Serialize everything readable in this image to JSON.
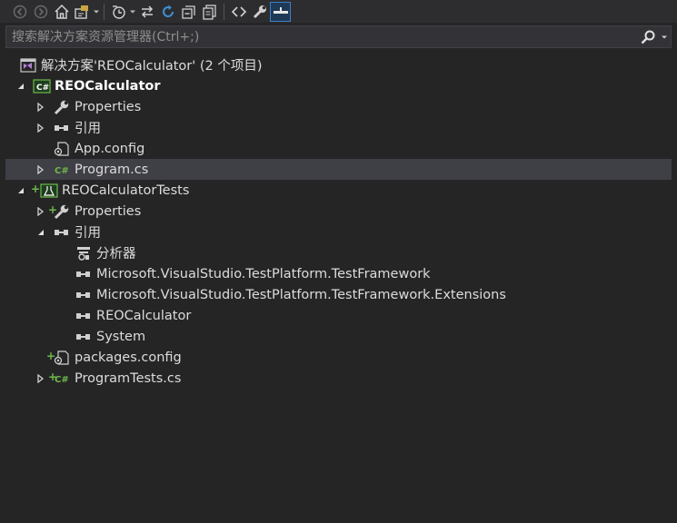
{
  "toolbar": {
    "buttons": [
      "back-icon",
      "forward-icon",
      "home-icon",
      "switch-views-icon",
      "pending-changes-icon",
      "sync-icon",
      "refresh-icon",
      "collapse-all-icon",
      "show-all-files-icon",
      "view-code-icon",
      "properties-icon",
      "preview-icon"
    ]
  },
  "search": {
    "placeholder": "搜索解决方案资源管理器(Ctrl+;)"
  },
  "tree": {
    "solution": "解决方案'REOCalculator' (2 个项目)",
    "proj1": "REOCalculator",
    "p1_properties": "Properties",
    "p1_refs": "引用",
    "p1_appconfig": "App.config",
    "p1_program": "Program.cs",
    "proj2": "REOCalculatorTests",
    "p2_properties": "Properties",
    "p2_refs": "引用",
    "ref_analyzers": "分析器",
    "ref_testframework": "Microsoft.VisualStudio.TestPlatform.TestFramework",
    "ref_testframework_ext": "Microsoft.VisualStudio.TestPlatform.TestFramework.Extensions",
    "ref_reocalc": "REOCalculator",
    "ref_system": "System",
    "p2_packages": "packages.config",
    "p2_programtests": "ProgramTests.cs"
  },
  "colors": {
    "background": "#252526",
    "toolbar": "#2d2d30",
    "selection": "#3f3f46",
    "csharp_green": "#6eb94b",
    "accent_blue": "#3d7ec6"
  }
}
